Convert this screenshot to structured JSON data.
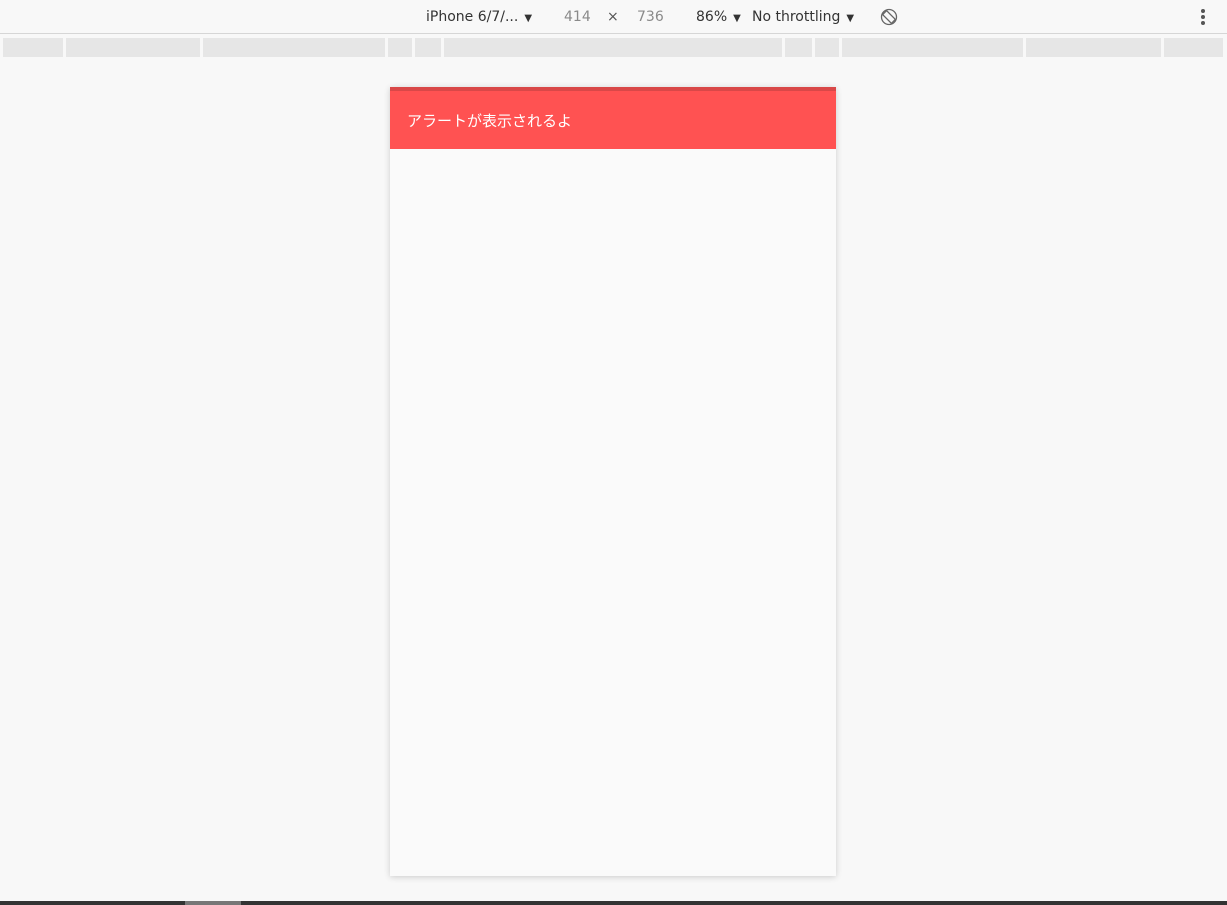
{
  "toolbar": {
    "device": "iPhone 6/7/...",
    "width": "414",
    "times": "×",
    "height": "736",
    "zoom": "86%",
    "throttling": "No throttling",
    "caret": "▼"
  },
  "alert": {
    "message": "アラートが表示されるよ",
    "color": "#ff5252"
  },
  "icons": {
    "rotate": "rotate-icon",
    "more": "more-vertical-icon"
  }
}
